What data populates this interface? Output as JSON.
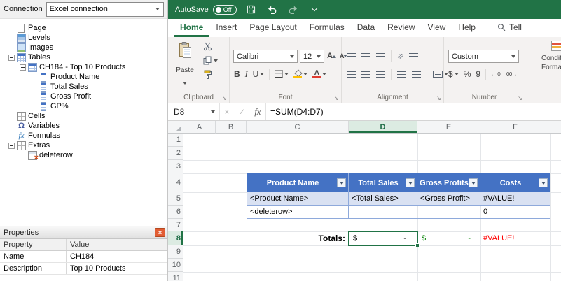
{
  "panel": {
    "connection_label": "Connection",
    "connection_value": "Excel connection",
    "tree": {
      "page": "Page",
      "levels": "Levels",
      "images": "Images",
      "tables": "Tables",
      "ch184": "CH184 - Top 10 Products",
      "product_name": "Product Name",
      "total_sales": "Total Sales",
      "gross_profit": "Gross Profit",
      "gp_pct": "GP%",
      "cells": "Cells",
      "variables": "Variables",
      "formulas": "Formulas",
      "extras": "Extras",
      "deleterow": "deleterow"
    },
    "properties": {
      "title": "Properties",
      "col_property": "Property",
      "col_value": "Value",
      "rows": [
        {
          "property": "Name",
          "value": "CH184"
        },
        {
          "property": "Description",
          "value": "Top 10 Products"
        }
      ]
    }
  },
  "excel": {
    "titlebar": {
      "autosave": "AutoSave",
      "autosave_state": "Off"
    },
    "tabs": {
      "home": "Home",
      "insert": "Insert",
      "page_layout": "Page Layout",
      "formulas": "Formulas",
      "data": "Data",
      "review": "Review",
      "view": "View",
      "help": "Help",
      "tell_me": "Tell"
    },
    "ribbon": {
      "paste": "Paste",
      "clipboard_label": "Clipboard",
      "font_name": "Calibri",
      "font_size": "12",
      "bold": "B",
      "italic": "I",
      "underline": "U",
      "font_label": "Font",
      "alignment_label": "Alignment",
      "number_format": "Custom",
      "currency": "$",
      "percent": "%",
      "comma": "9",
      "number_label": "Number",
      "cond1": "Conditional",
      "cond2": "Formatting"
    },
    "formula_bar": {
      "cell_ref": "D8",
      "formula": "=SUM(D4:D7)"
    },
    "grid": {
      "col_headers": [
        "A",
        "B",
        "C",
        "D",
        "E",
        "F"
      ],
      "row_headers": [
        "1",
        "2",
        "3",
        "4",
        "5",
        "6",
        "7",
        "8",
        "9",
        "10",
        "11"
      ],
      "table_headers": [
        "Product Name",
        "Total Sales",
        "Gross Profits",
        "Costs"
      ],
      "row5": [
        "<Product Name>",
        "<Total Sales>",
        "<Gross Profit>",
        "#VALUE!"
      ],
      "row6": [
        "<deleterow>",
        "0"
      ],
      "totals_label": "Totals:",
      "d8": {
        "sym": "$",
        "val": "-"
      },
      "e8": {
        "sym": "$",
        "val": "-"
      },
      "f8": "#VALUE!"
    }
  }
}
